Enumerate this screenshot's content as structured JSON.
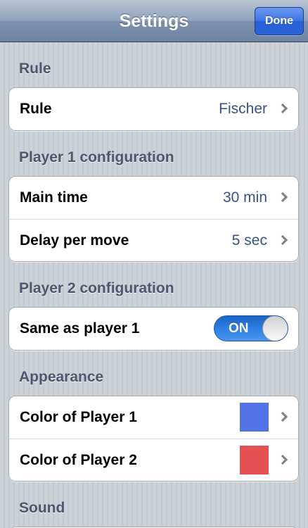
{
  "navbar": {
    "title": "Settings",
    "done_label": "Done"
  },
  "sections": {
    "rule": {
      "header": "Rule",
      "rows": [
        {
          "label": "Rule",
          "value": "Fischer"
        }
      ]
    },
    "player1": {
      "header": "Player 1 configuration",
      "rows": [
        {
          "label": "Main time",
          "value": "30 min"
        },
        {
          "label": "Delay per move",
          "value": "5 sec"
        }
      ]
    },
    "player2": {
      "header": "Player 2 configuration",
      "rows": [
        {
          "label": "Same as player 1",
          "toggle": "ON"
        }
      ]
    },
    "appearance": {
      "header": "Appearance",
      "rows": [
        {
          "label": "Color of Player 1",
          "color": "#5173e6"
        },
        {
          "label": "Color of Player 2",
          "color": "#e55052"
        }
      ]
    },
    "sound": {
      "header": "Sound"
    }
  }
}
